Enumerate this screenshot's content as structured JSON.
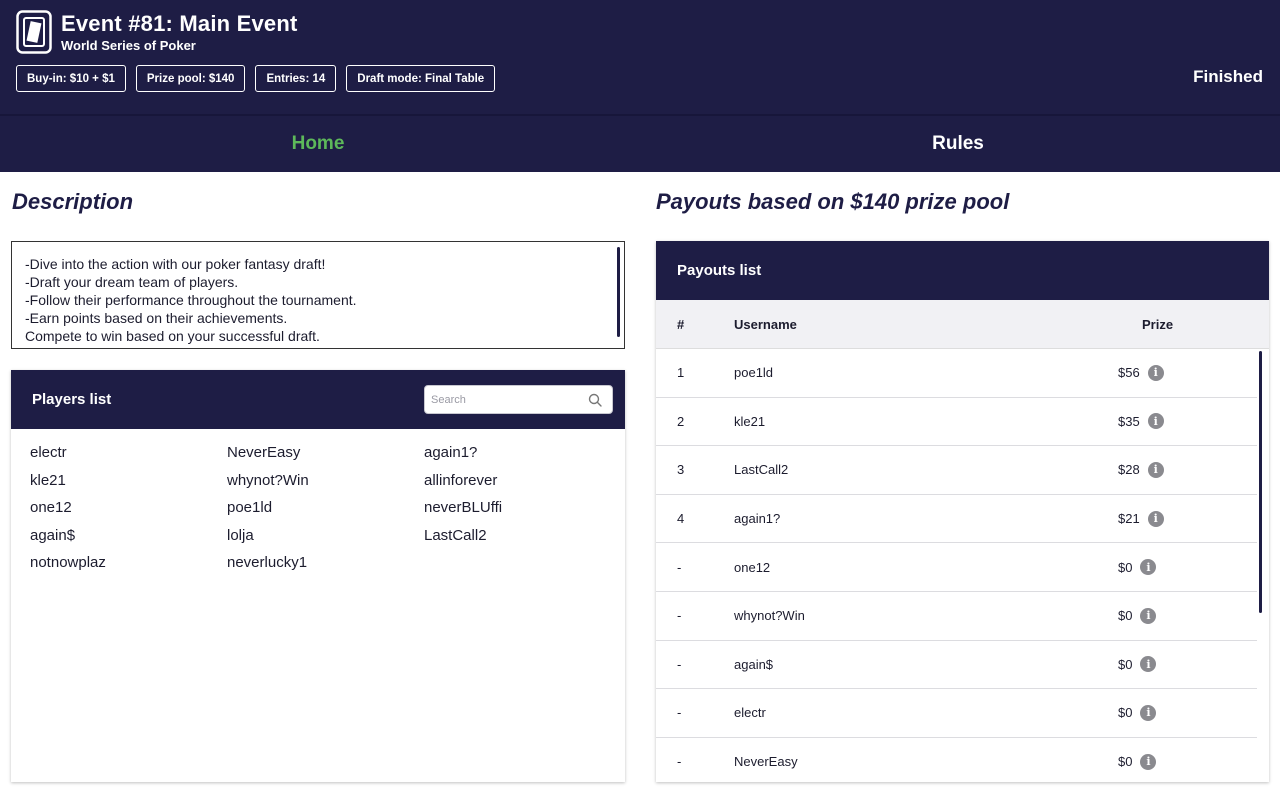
{
  "header": {
    "title": "Event #81: Main Event",
    "subtitle": "World Series of Poker",
    "status": "Finished",
    "badges": [
      {
        "label": "Buy-in: $10 + $1"
      },
      {
        "label": "Prize pool: $140"
      },
      {
        "label": "Entries: 14"
      },
      {
        "label": "Draft mode: Final Table"
      }
    ],
    "logo_icon": "playing-card-icon"
  },
  "nav": {
    "tabs": [
      {
        "label": "Home",
        "active": true
      },
      {
        "label": "Rules",
        "active": false
      }
    ],
    "active_color": "#5db85a"
  },
  "description": {
    "title": "Description",
    "lines": [
      "-Dive into the action with our poker fantasy draft!",
      "-Draft your dream team of players.",
      "-Follow their performance throughout the tournament.",
      "-Earn points based on their achievements.",
      "Compete to win based on your successful draft."
    ]
  },
  "players": {
    "title": "Players list",
    "search_placeholder": "Search",
    "items": [
      "electr",
      "NeverEasy",
      "again1?",
      "kle21",
      "whynot?Win",
      "allinforever",
      "one12",
      "poe1ld",
      "neverBLUffi",
      "again$",
      "lolja",
      "LastCall2",
      "notnowplaz",
      "neverlucky1"
    ]
  },
  "payouts": {
    "title": "Payouts based on $140 prize pool",
    "panel_title": "Payouts list",
    "columns": {
      "rank": "#",
      "username": "Username",
      "prize": "Prize"
    },
    "info_icon": "i",
    "rows": [
      {
        "rank": "1",
        "username": "poe1ld",
        "prize": "$56"
      },
      {
        "rank": "2",
        "username": "kle21",
        "prize": "$35"
      },
      {
        "rank": "3",
        "username": "LastCall2",
        "prize": "$28"
      },
      {
        "rank": "4",
        "username": "again1?",
        "prize": "$21"
      },
      {
        "rank": "-",
        "username": "one12",
        "prize": "$0"
      },
      {
        "rank": "-",
        "username": "whynot?Win",
        "prize": "$0"
      },
      {
        "rank": "-",
        "username": "again$",
        "prize": "$0"
      },
      {
        "rank": "-",
        "username": "electr",
        "prize": "$0"
      },
      {
        "rank": "-",
        "username": "NeverEasy",
        "prize": "$0"
      }
    ]
  },
  "colors": {
    "header_bg": "#1e1d45",
    "accent_green": "#5db85a"
  }
}
